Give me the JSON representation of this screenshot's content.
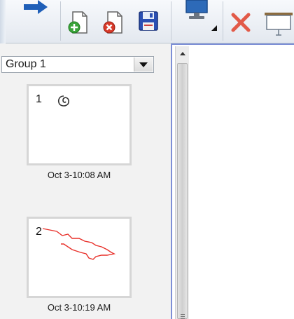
{
  "toolbar": {
    "buttons": [
      {
        "name": "forward-arrow",
        "icon": "arrow-right-icon"
      },
      {
        "name": "add-page",
        "icon": "add-page-icon"
      },
      {
        "name": "remove-page",
        "icon": "remove-page-icon"
      },
      {
        "name": "save",
        "icon": "floppy-disk-icon"
      },
      {
        "name": "display",
        "icon": "monitor-icon"
      },
      {
        "name": "delete",
        "icon": "red-x-icon"
      },
      {
        "name": "presentation",
        "icon": "projector-screen-icon"
      }
    ]
  },
  "group_selector": {
    "selected": "Group 1"
  },
  "pages": [
    {
      "number": "1",
      "timestamp": "Oct 3-10:08 AM"
    },
    {
      "number": "2",
      "timestamp": "Oct 3-10:19 AM"
    }
  ],
  "colors": {
    "accent_blue": "#7d8fd6",
    "ink_red": "#e8302a",
    "save_blue": "#2a4fb3",
    "add_green": "#3aa43a",
    "remove_red": "#d83a2a"
  }
}
